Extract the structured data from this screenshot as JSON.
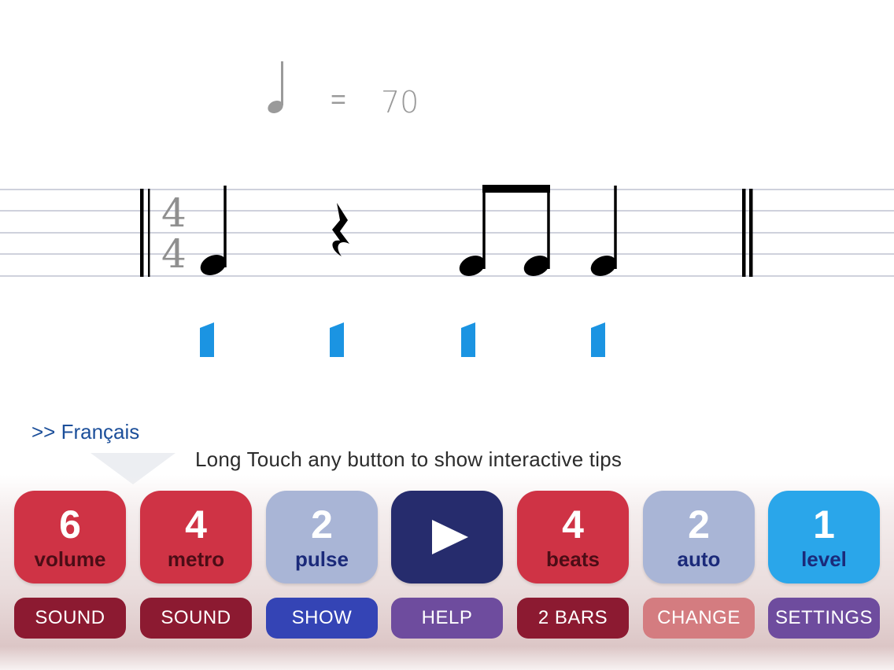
{
  "tempo": {
    "equals": "=",
    "bpm": "70"
  },
  "score": {
    "time_signature": {
      "numerator": "4",
      "denominator": "4"
    }
  },
  "language_link": ">> Français",
  "tip": "Long Touch any button to show interactive tips",
  "controls": [
    {
      "name": "volume",
      "number": "6",
      "label": "volume",
      "sub": "SOUND",
      "bg": "#cf3345",
      "label_color": "#4b0d16",
      "sub_bg": "#8c1a31"
    },
    {
      "name": "metro",
      "number": "4",
      "label": "metro",
      "sub": "SOUND",
      "bg": "#cf3345",
      "label_color": "#4b0d16",
      "sub_bg": "#8c1a31"
    },
    {
      "name": "pulse",
      "number": "2",
      "label": "pulse",
      "sub": "SHOW",
      "bg": "#a9b5d6",
      "label_color": "#1b2a7a",
      "sub_bg": "#3444b5"
    },
    {
      "name": "play",
      "sub": "HELP",
      "bg": "#262c6d",
      "sub_bg": "#6e4c9e"
    },
    {
      "name": "beats",
      "number": "4",
      "label": "beats",
      "sub": "2 BARS",
      "bg": "#cf3345",
      "label_color": "#4b0d16",
      "sub_bg": "#8c1a31"
    },
    {
      "name": "auto",
      "number": "2",
      "label": "auto",
      "sub": "CHANGE",
      "bg": "#a9b5d6",
      "label_color": "#1b2a7a",
      "sub_bg": "#d47c80"
    },
    {
      "name": "level",
      "number": "1",
      "label": "level",
      "sub": "SETTINGS",
      "bg": "#2aa6ea",
      "label_color": "#1b2a7a",
      "sub_bg": "#6e4c9e"
    }
  ],
  "colors": {
    "pulse_marker": "#1b94e2",
    "note": "#000000",
    "staff_line": "#cfd1dc"
  }
}
